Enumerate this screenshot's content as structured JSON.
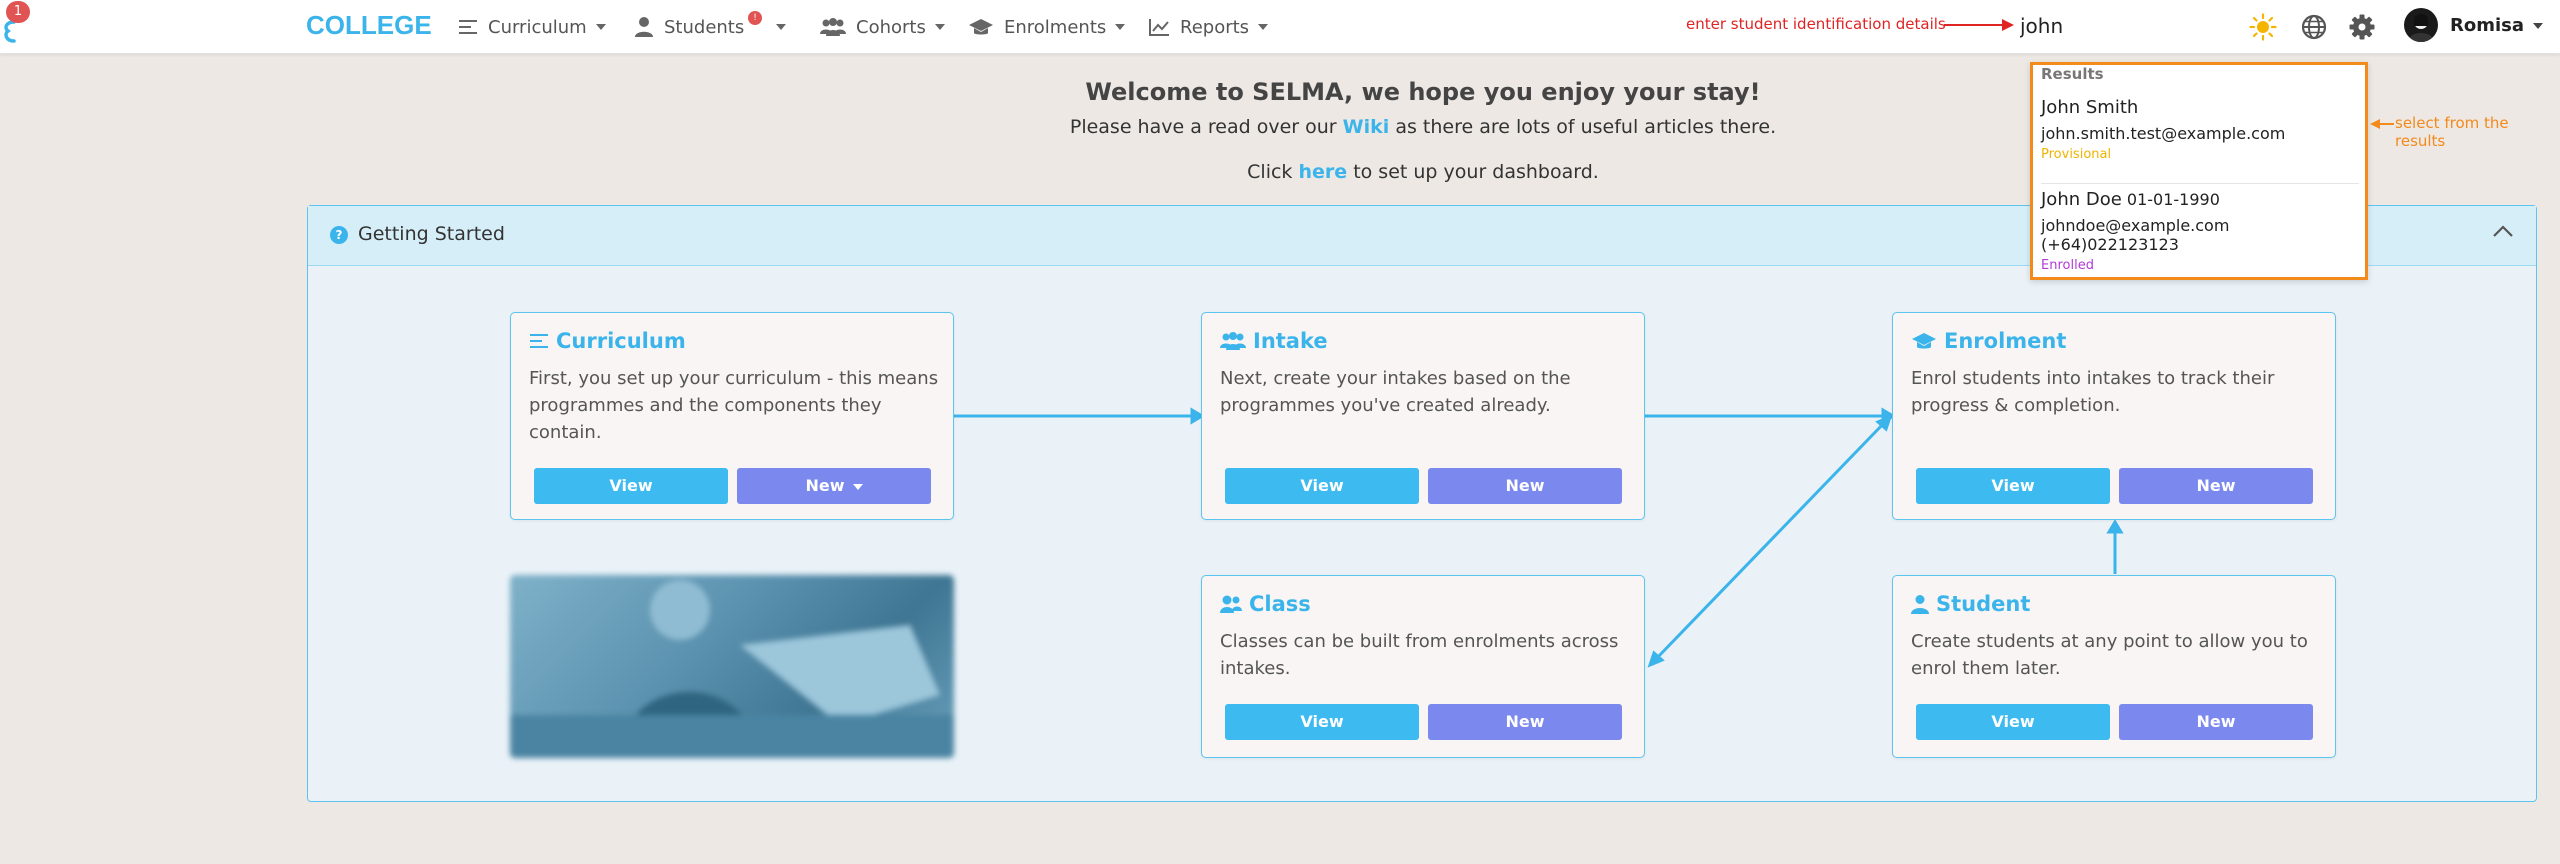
{
  "nav": {
    "notification_count": "1",
    "brand": "COLLEGE",
    "items": [
      {
        "label": "Curriculum",
        "icon": "list-icon"
      },
      {
        "label": "Students",
        "icon": "user-icon",
        "badge": "!"
      },
      {
        "label": "Cohorts",
        "icon": "users-icon"
      },
      {
        "label": "Enrolments",
        "icon": "graduation-cap-icon"
      },
      {
        "label": "Reports",
        "icon": "chart-line-icon"
      }
    ],
    "search_value": "john",
    "user_name": "Romisa"
  },
  "annotations": {
    "search_hint": "enter student identification details",
    "results_hint": "select from the results"
  },
  "welcome": {
    "title": "Welcome to SELMA, we hope you enjoy your stay!",
    "line1_before": "Please have a read over our ",
    "line1_link": "Wiki",
    "line1_after": " as there are lots of useful articles there.",
    "line2_before": "Click ",
    "line2_link": "here",
    "line2_after": " to set up your dashboard."
  },
  "panel": {
    "title": "Getting Started",
    "cards": {
      "curriculum": {
        "title": "Curriculum",
        "text": "First, you set up your curriculum - this means programmes and the components they contain.",
        "view": "View",
        "new": "New"
      },
      "intake": {
        "title": "Intake",
        "text": "Next, create your intakes based on the programmes you've created already.",
        "view": "View",
        "new": "New"
      },
      "enrolment": {
        "title": "Enrolment",
        "text": "Enrol students into intakes to track their progress & completion.",
        "view": "View",
        "new": "New"
      },
      "class": {
        "title": "Class",
        "text": "Classes can be built from enrolments across intakes.",
        "view": "View",
        "new": "New"
      },
      "student": {
        "title": "Student",
        "text": "Create students at any point to allow you to enrol them later.",
        "view": "View",
        "new": "New"
      }
    }
  },
  "results": {
    "title": "Results",
    "items": [
      {
        "name": "John Smith",
        "dob": "",
        "email": "john.smith.test@example.com",
        "status": "Provisional",
        "status_color": "#f0b400"
      },
      {
        "name": "John Doe",
        "dob": "01-01-1990",
        "email": "johndoe@example.com (+64)022123123",
        "status": "Enrolled",
        "status_color": "#b23bd6"
      }
    ]
  },
  "colors": {
    "accent": "#3ab4ea",
    "new_button": "#7b89ef",
    "highlight": "#f28a1c",
    "hint_red": "#e02424"
  }
}
